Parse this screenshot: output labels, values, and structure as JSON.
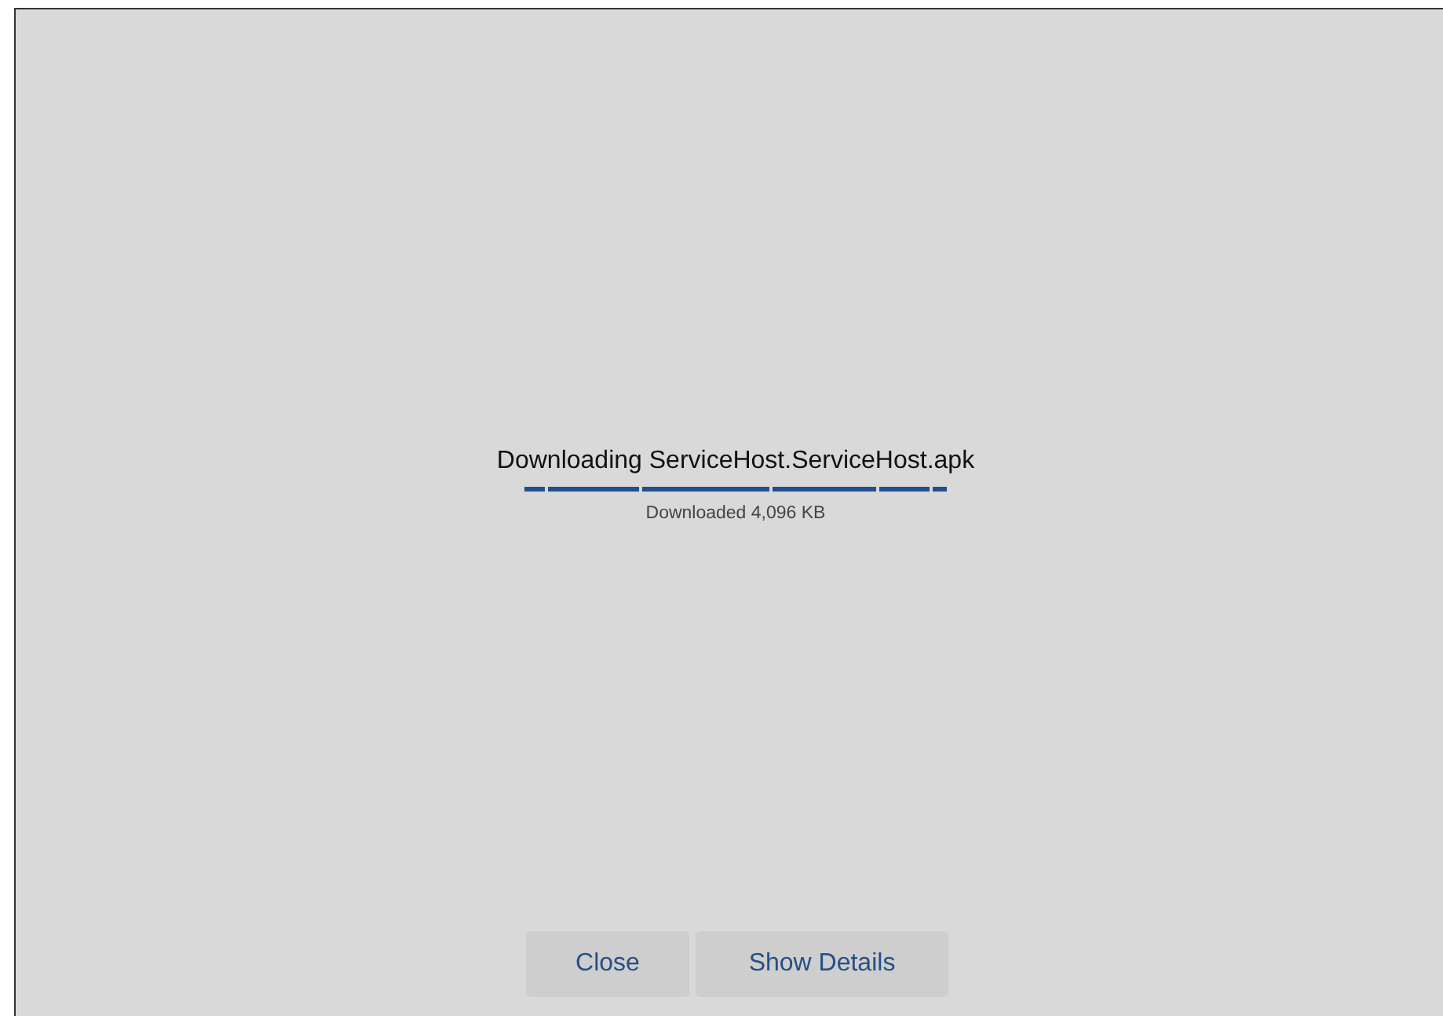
{
  "title": "Downloading ServiceHost.ServiceHost.apk",
  "status": "Downloaded 4,096 KB",
  "buttons": [
    {
      "label": "Close"
    },
    {
      "label": "Show Details"
    }
  ]
}
